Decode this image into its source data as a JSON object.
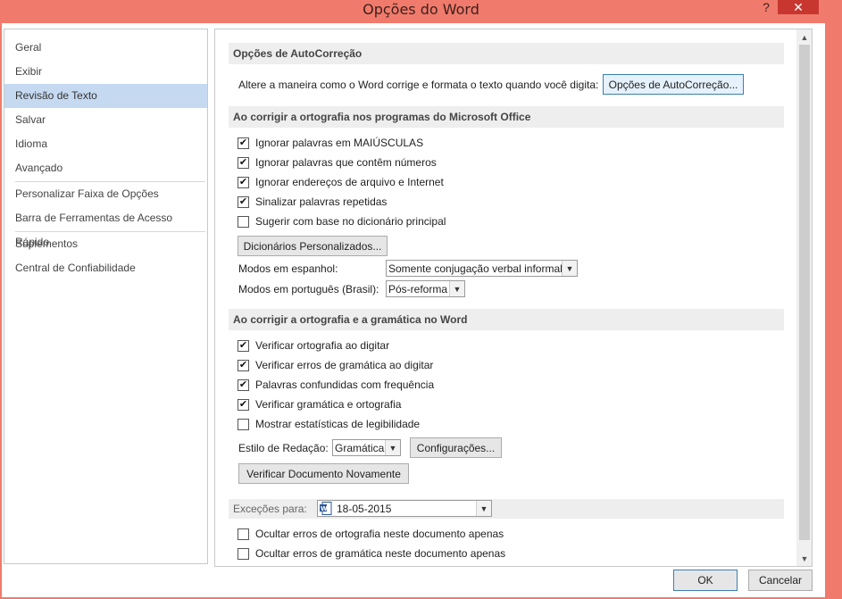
{
  "window": {
    "title": "Opções do Word",
    "help_label": "?",
    "close_label": "✕"
  },
  "sidebar": {
    "items": [
      {
        "label": "Geral"
      },
      {
        "label": "Exibir"
      },
      {
        "label": "Revisão de Texto",
        "active": true
      },
      {
        "label": "Salvar"
      },
      {
        "label": "Idioma"
      },
      {
        "label": "Avançado"
      },
      {
        "label": "Personalizar Faixa de Opções"
      },
      {
        "label": "Barra de Ferramentas de Acesso Rápido"
      },
      {
        "label": "Suplementos"
      },
      {
        "label": "Central de Confiabilidade"
      }
    ]
  },
  "autocorrect": {
    "header": "Opções de AutoCorreção",
    "description": "Altere a maneira como o Word corrige e formata o texto quando você digita:",
    "button": "Opções de AutoCorreção..."
  },
  "office_spelling": {
    "header": "Ao corrigir a ortografia nos programas do Microsoft Office",
    "options": [
      {
        "label": "Ignorar palavras em MAIÚSCULAS",
        "checked": true
      },
      {
        "label": "Ignorar palavras que contêm números",
        "checked": true
      },
      {
        "label": "Ignorar endereços de arquivo e Internet",
        "checked": true
      },
      {
        "label": "Sinalizar palavras repetidas",
        "checked": true
      },
      {
        "label": "Sugerir com base no dicionário principal",
        "checked": false
      }
    ],
    "dictionaries_button": "Dicionários Personalizados...",
    "spanish_label": "Modos em espanhol:",
    "spanish_value": "Somente conjugação verbal informal",
    "portuguese_label": "Modos em português (Brasil):",
    "portuguese_value": "Pós-reforma"
  },
  "word_spelling": {
    "header": "Ao corrigir a ortografia e a gramática no Word",
    "options": [
      {
        "label": "Verificar ortografia ao digitar",
        "checked": true
      },
      {
        "label": "Verificar erros de gramática ao digitar",
        "checked": true
      },
      {
        "label": "Palavras confundidas com frequência",
        "checked": true
      },
      {
        "label": "Verificar gramática e ortografia",
        "checked": true
      },
      {
        "label": "Mostrar estatísticas de legibilidade",
        "checked": false
      }
    ],
    "style_label": "Estilo de Redação:",
    "style_value": "Gramática",
    "settings_button": "Configurações...",
    "recheck_button": "Verificar Documento Novamente"
  },
  "exceptions": {
    "label": "Exceções para:",
    "document": "18-05-2015",
    "options": [
      {
        "label": "Ocultar erros de ortografia neste documento apenas",
        "checked": false
      },
      {
        "label": "Ocultar erros de gramática neste documento apenas",
        "checked": false
      }
    ]
  },
  "footer": {
    "ok": "OK",
    "cancel": "Cancelar"
  },
  "colors": {
    "titlebar": "#f07b6c",
    "close": "#c7372f",
    "selected_nav": "#c5d9f1"
  }
}
